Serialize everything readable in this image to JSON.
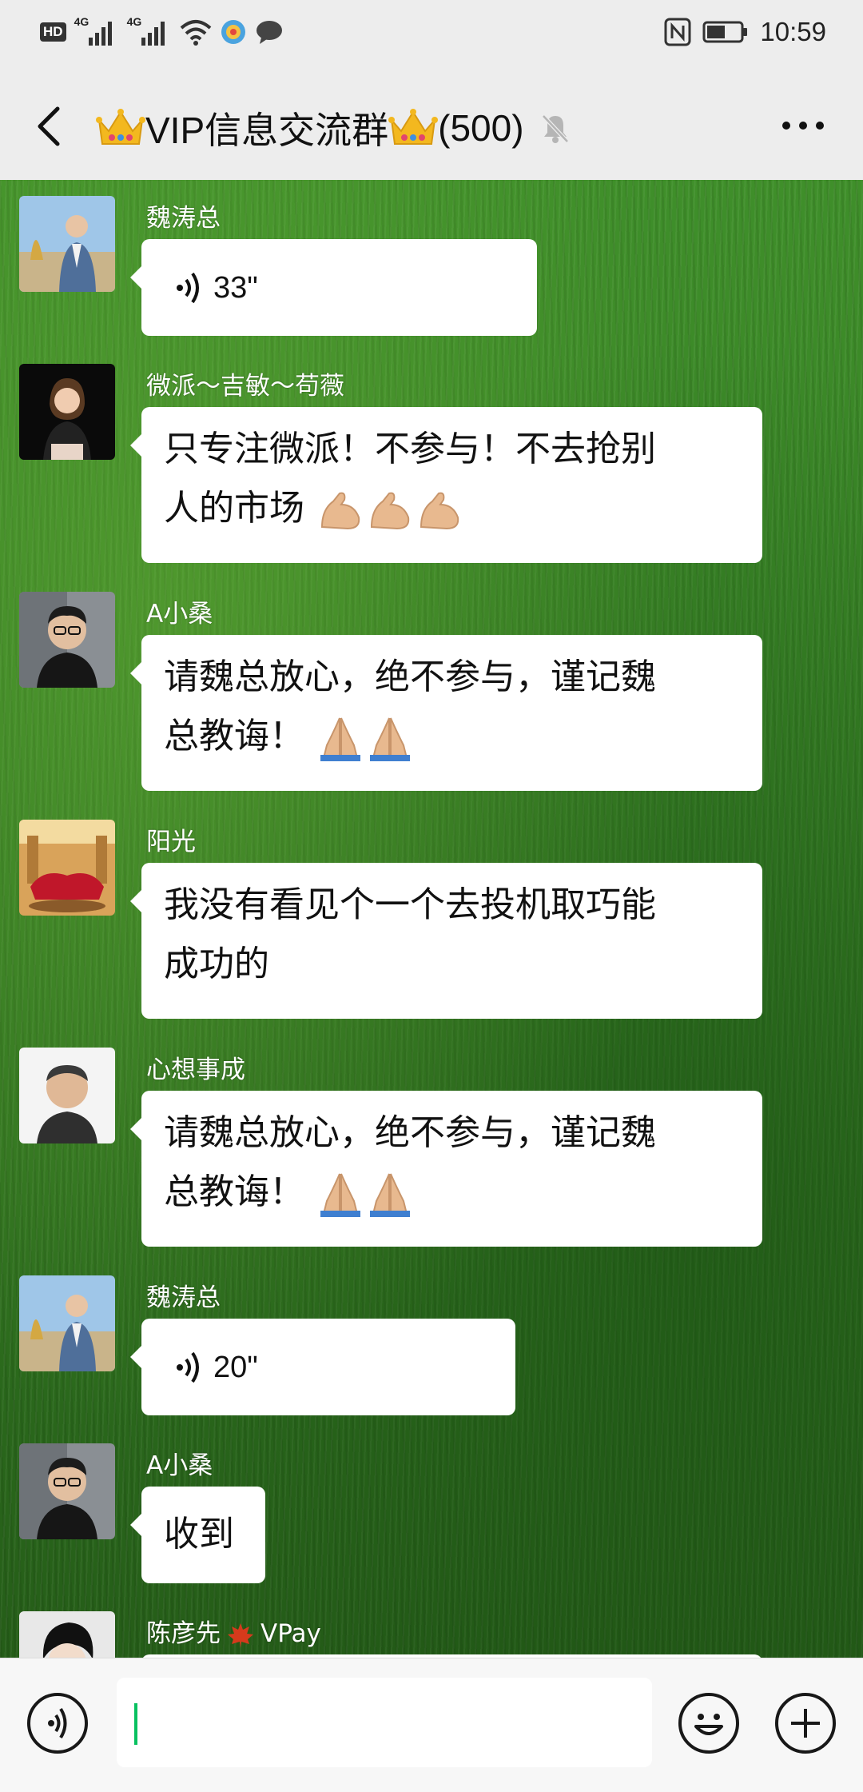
{
  "status_bar": {
    "hd": "HD",
    "network1": "4G",
    "network2": "4G",
    "time": "10:59"
  },
  "header": {
    "title": "VIP信息交流群",
    "member_count": "(500)"
  },
  "messages": [
    {
      "sender": "魏涛总",
      "type": "voice",
      "duration": "33\""
    },
    {
      "sender": "微派～吉敏～苟薇",
      "type": "text",
      "line1": "只专注微派！不参与！不去抢别",
      "line2": "人的市场"
    },
    {
      "sender": "A小桑",
      "type": "text",
      "line1": "请魏总放心，绝不参与，谨记魏",
      "line2": "总教诲！"
    },
    {
      "sender": "阳光",
      "type": "text",
      "line1": "我没有看见个一个去投机取巧能",
      "line2": "成功的"
    },
    {
      "sender": "心想事成",
      "type": "text",
      "line1": "请魏总放心，绝不参与，谨记魏",
      "line2": "总教诲！"
    },
    {
      "sender": "魏涛总",
      "type": "voice",
      "duration": "20\""
    },
    {
      "sender": "A小桑",
      "type": "text",
      "line1": "收到"
    },
    {
      "sender": "陈彦先",
      "sender_suffix": "VPay"
    }
  ],
  "icons": {
    "back": "chevron-left-icon",
    "mute": "bell-mute-icon",
    "more": "more-dots-icon",
    "voice_toggle": "voice-input-icon",
    "emoji": "emoji-smile-icon",
    "add": "plus-icon",
    "wifi": "wifi-icon",
    "nfc": "nfc-icon",
    "battery": "battery-icon"
  },
  "colors": {
    "caret": "#07c160",
    "chat_bg": "#367f24",
    "bar_bg": "#ededed"
  }
}
